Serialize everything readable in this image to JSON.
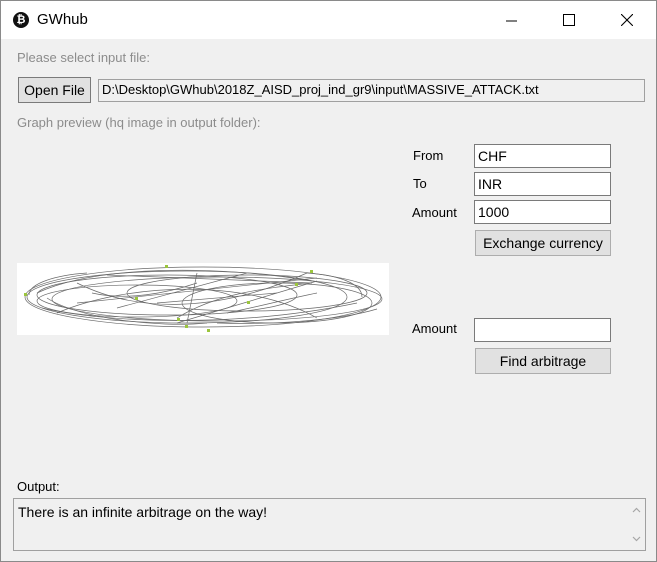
{
  "window": {
    "title": "GWhub",
    "app_icon": "bitcoin-icon"
  },
  "labels": {
    "select_file": "Please select input file:",
    "graph_preview": "Graph preview (hq image in output folder):",
    "from": "From",
    "to": "To",
    "amount_exchange": "Amount",
    "amount_arbitrage": "Amount",
    "output": "Output:"
  },
  "buttons": {
    "open_file": "Open File",
    "exchange": "Exchange currency",
    "find_arbitrage": "Find arbitrage"
  },
  "fields": {
    "file_path": "D:\\Desktop\\GWhub\\2018Z_AISD_proj_ind_gr9\\input\\MASSIVE_ATTACK.txt",
    "from": "CHF",
    "to": "INR",
    "amount": "1000",
    "arbitrage_amount": ""
  },
  "output": {
    "text": "There is an infinite arbitrage on the way!"
  }
}
